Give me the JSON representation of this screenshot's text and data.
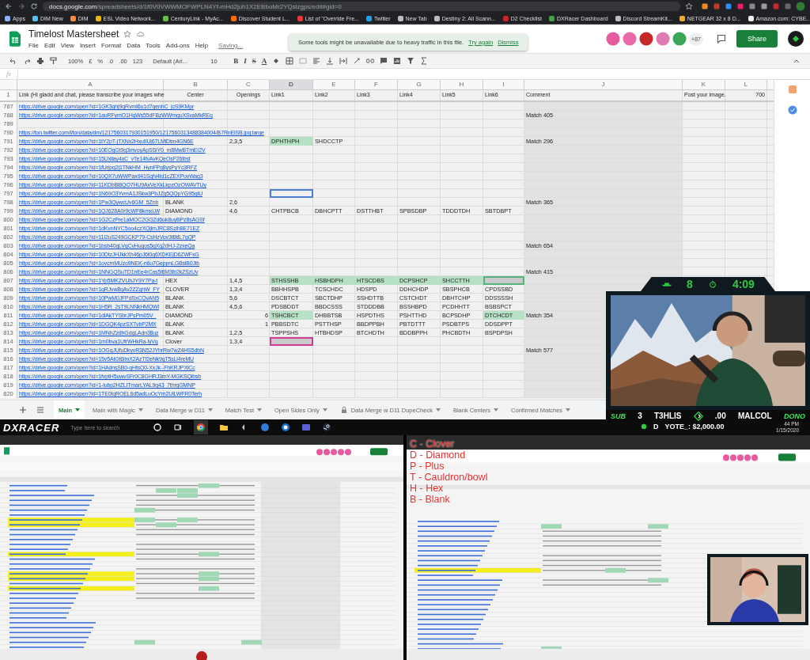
{
  "browser": {
    "url_host": "docs.google.com",
    "url_path": "/spreadsheets/d/1f0V0VWWMOFWPLN4Yf-mHd2juh1X2EBboMr2YQslzgps/edit#gid=0",
    "bookmarks": [
      {
        "label": "Apps",
        "color": "#8ab4f8"
      },
      {
        "label": "DIM New",
        "color": "#4fc3f7"
      },
      {
        "label": "DIM",
        "color": "#ff8a3d"
      },
      {
        "label": "ESL Video Network...",
        "color": "#f5b400"
      },
      {
        "label": "CenturyLink - MyAc...",
        "color": "#6abf4b"
      },
      {
        "label": "Discover Student L...",
        "color": "#ff6d00"
      },
      {
        "label": "List of \"Override Fre...",
        "color": "#e53935"
      },
      {
        "label": "Twitter",
        "color": "#1da1f2"
      },
      {
        "label": "New Tab",
        "color": "#bdbdbd"
      },
      {
        "label": "Destiny 2: All Scann...",
        "color": "#bdbdbd"
      },
      {
        "label": "D2 Checklist",
        "color": "#c62828"
      },
      {
        "label": "DXRacer Dashboard",
        "color": "#43a047"
      },
      {
        "label": "Discord StreamKit...",
        "color": "#bdbdbd"
      },
      {
        "label": "NETGEAR 32 x 8 D...",
        "color": "#f9a825"
      },
      {
        "label": "Amazon.com: CYBE...",
        "color": "#eeeeee"
      }
    ]
  },
  "sheet": {
    "title": "Timelost Mastersheet",
    "menu": [
      "File",
      "Edit",
      "View",
      "Insert",
      "Format",
      "Data",
      "Tools",
      "Add-ons",
      "Help"
    ],
    "save_status": "Saving...",
    "notice": {
      "text": "Some tools might be unavailable due to heavy traffic in this file.",
      "actions": [
        "Try again",
        "Dismiss"
      ]
    },
    "collaborators": [
      {
        "color": "#e85aa0"
      },
      {
        "color": "#e86aa8"
      },
      {
        "color": "#c62828"
      },
      {
        "color": "#e07ab0"
      },
      {
        "color": "#3aa757"
      }
    ],
    "collaborator_count": "+87",
    "share": "Share",
    "toolbar": {
      "zoom": "100%",
      "currency": "£",
      "percent": "%",
      "decimals_less": ".0",
      "decimals_more": ".00",
      "number_format": "123",
      "font": "Default (Ari...",
      "font_size": "10",
      "styles": [
        "B",
        "I",
        "S",
        "A"
      ]
    },
    "formula_label": "fx",
    "columns": [
      {
        "letter": "A",
        "selected": false
      },
      {
        "letter": "B",
        "selected": false
      },
      {
        "letter": "C",
        "selected": false
      },
      {
        "letter": "D",
        "selected": true
      },
      {
        "letter": "E",
        "selected": false
      },
      {
        "letter": "F",
        "selected": false
      },
      {
        "letter": "G",
        "selected": false
      },
      {
        "letter": "H",
        "selected": false
      },
      {
        "letter": "I",
        "selected": false
      },
      {
        "letter": "J",
        "selected": false
      },
      {
        "letter": "K",
        "selected": false
      },
      {
        "letter": "L",
        "selected": false
      }
    ],
    "header_row": {
      "number": "1",
      "cells": [
        "Link (Hi gladd and chat, please transcribe your images whe",
        "Center",
        "Openings",
        "Link1",
        "Link2",
        "Link3",
        "Link4",
        "Link5",
        "Link6",
        "Comment",
        "Post your image.",
        "700"
      ]
    },
    "rows": [
      {
        "number": "787",
        "link": "https://drive.google.com/open?id=1GK3ghj9gRvmI6u1d7genhC_jcS9KMpr"
      },
      {
        "number": "788",
        "link": "https://drive.google.com/open?id=1auRFymO1HqWs55dFBzWWmguXSvaMkREq",
        "comment": "Match 405"
      },
      {
        "number": "789"
      },
      {
        "number": "790",
        "link": "https://ton.twitter.com/i/ton/data/dm/1217560317930151950/1217560313488384004/B7RnElSB.jpg:large"
      },
      {
        "number": "791",
        "link": "https://drive.google.com/open?id=1tY2pT-jTXNx2HxuIIUj67LMlDtm4GN6E",
        "openings": "2,3,5",
        "openings_numeric": false,
        "links": [
          {
            "text": "DPHTHPH",
            "highlighted": true,
            "selected": false
          },
          {
            "text": "SHDCCTP",
            "highlighted": false,
            "selected": false
          },
          {
            "highlighted": false,
            "selected": false
          },
          {
            "highlighted": false,
            "selected": false
          },
          {
            "highlighted": false,
            "selected": false
          },
          {
            "highlighted": false,
            "selected": false
          }
        ],
        "comment": "Match 296"
      },
      {
        "number": "792",
        "link": "https://drive.google.com/open?id=10EOgGt9g3mvoyApSSlY0_m8MwBTmEI2V"
      },
      {
        "number": "793",
        "link": "https://drive.google.com/open?id=15Uxllay4xC_vTe14fvAvKQeOsF26lbst"
      },
      {
        "number": "794",
        "link": "https://drive.google.com/open?id=1fUrjpg2j1TNkHM_HynFPg8ysPyYc3RFZ"
      },
      {
        "number": "795",
        "link": "https://drive.google.com/open?id=10QX7uWWPax941SgN4td1cZEXPovWag3"
      },
      {
        "number": "796",
        "link": "https://drive.google.com/open?id=11KDbBl8QO7HU9AxVeXkLkpzOzOWAVTUy"
      },
      {
        "number": "797",
        "link": "https://drive.google.com/open?id=1N69O3YvmA1JSkw3PbJZg5QQpYG95gIU",
        "links": [
          {
            "highlighted": false,
            "selected": true
          },
          {
            "highlighted": false,
            "selected": false
          },
          {
            "highlighted": false,
            "selected": false
          },
          {
            "highlighted": false,
            "selected": false
          },
          {
            "highlighted": false,
            "selected": false
          },
          {
            "highlighted": false,
            "selected": false
          }
        ]
      },
      {
        "number": "798",
        "link": "https://drive.google.com/open?id=1Pw3QywcUv6GM_5Znh",
        "center": "BLANK",
        "openings": "2,6",
        "openings_numeric": false,
        "comment": "Match 365"
      },
      {
        "number": "799",
        "link": "https://drive.google.com/open?id=1QJ628A0r9cWF8kmxLW",
        "center": "DIAMOND",
        "openings": "4,6",
        "openings_numeric": false,
        "links": [
          {
            "text": "CHTPBCB",
            "highlighted": false,
            "selected": false
          },
          {
            "text": "DBHCPTT",
            "highlighted": false,
            "selected": false
          },
          {
            "text": "DSTTHBT",
            "highlighted": false,
            "selected": false
          },
          {
            "text": "SPBSDBP",
            "highlighted": false,
            "selected": false
          },
          {
            "text": "TDDDTDH",
            "highlighted": false,
            "selected": false
          },
          {
            "text": "SBTDBPT",
            "highlighted": false,
            "selected": false
          }
        ]
      },
      {
        "number": "800",
        "link": "https://drive.google.com/open?id=1G2CzPre1aMOC2GGZd6uk8uyBPz8sAGSf"
      },
      {
        "number": "801",
        "link": "https://drive.google.com/open?id=1dKvnNYC5oo4czXQjimJRC8Szlh8E71EZ"
      },
      {
        "number": "802",
        "link": "https://drive.google.com/open?id=11I2uS249GCKP79-CsHzVov3tBtlL7gQP"
      },
      {
        "number": "803",
        "link": "https://drive.google.com/open?id=1bsb40gLVqCvHuqos5gXq2dHJ-2zxeQa",
        "comment": "Match 654"
      },
      {
        "number": "804",
        "link": "https://drive.google.com/open?id=10DtzJHJkkXh46pJ6t0g6XDKEjD6ZWFxG"
      },
      {
        "number": "805",
        "link": "https://drive.google.com/open?id=1ovcmMUzo9NEK-n6u7GeppnLGBslB0Jlb"
      },
      {
        "number": "806",
        "link": "https://drive.google.com/open?id=1NNGQSuTD1nEe4rCas5l6M3lb2kZSzUv",
        "comment": "Match 415"
      },
      {
        "number": "807",
        "link": "https://drive.google.com/open?id=1Yp5MKZVUhJY9Y7Pa-t",
        "center": "HEX",
        "openings": "1,4,5",
        "openings_numeric": false,
        "links": [
          {
            "text": "STHSSHB",
            "highlighted": true,
            "selected": false
          },
          {
            "text": "HSBHDPH",
            "highlighted": true,
            "selected": false
          },
          {
            "text": "HTSCDBS",
            "highlighted": true,
            "selected": false
          },
          {
            "text": "DCPSHCP",
            "highlighted": true,
            "selected": false
          },
          {
            "text": "SHCCTTH",
            "highlighted": true,
            "selected": false
          },
          {
            "highlighted": false,
            "selected": false,
            "color": "#56b37a"
          }
        ]
      },
      {
        "number": "808",
        "link": "https://drive.google.com/open?id=1qRJvw8qAv2ZZqhW_FY",
        "center": "CLOVER",
        "openings": "1,3,4",
        "openings_numeric": false,
        "links": [
          {
            "text": "BBHHSPB",
            "highlighted": false,
            "selected": false
          },
          {
            "text": "TCSCHDC",
            "highlighted": false,
            "selected": false
          },
          {
            "text": "HDSPD",
            "highlighted": false,
            "selected": false
          },
          {
            "text": "DDHCHDP",
            "highlighted": false,
            "selected": false
          },
          {
            "text": "SBSPHCB",
            "highlighted": false,
            "selected": false
          },
          {
            "text": "CPDSSBD",
            "highlighted": false,
            "selected": false
          }
        ]
      },
      {
        "number": "809",
        "link": "https://drive.google.com/open?id=10PwM0JFPdSxCQvAN5",
        "center": "BLANK",
        "openings": "5,6",
        "openings_numeric": false,
        "links": [
          {
            "text": "DSCBTCT",
            "highlighted": false,
            "selected": false
          },
          {
            "text": "SBCTDHP",
            "highlighted": false,
            "selected": false
          },
          {
            "text": "SSHDTTB",
            "highlighted": false,
            "selected": false
          },
          {
            "text": "CSTCHDT",
            "highlighted": false,
            "selected": false
          },
          {
            "text": "DBHTCHP",
            "highlighted": false,
            "selected": false
          },
          {
            "text": "DDSSSSH",
            "highlighted": false,
            "selected": false
          }
        ]
      },
      {
        "number": "810",
        "link": "https://drive.google.com/open?id=1H5R_2sT9LNNkHMQWl",
        "center": "BLANK",
        "openings": "4,5,6",
        "openings_numeric": false,
        "links": [
          {
            "text": "PDSBDDT",
            "highlighted": false,
            "selected": false
          },
          {
            "text": "BBDCSSS",
            "highlighted": false,
            "selected": false
          },
          {
            "text": "STDDDBB",
            "highlighted": false,
            "selected": false
          },
          {
            "text": "BSSHBPD",
            "highlighted": false,
            "selected": false
          },
          {
            "text": "PCDHHTT",
            "highlighted": false,
            "selected": false
          },
          {
            "text": "BSBSPCT",
            "highlighted": false,
            "selected": false
          }
        ]
      },
      {
        "number": "811",
        "link": "https://drive.google.com/open?id=1dlAkTYSbrJPsPm05V_",
        "center": "DIAMOND",
        "openings": "6",
        "openings_numeric": true,
        "links": [
          {
            "text": "TSHCBCT",
            "highlighted": true,
            "selected": false
          },
          {
            "text": "DHBBTSB",
            "highlighted": false,
            "selected": false
          },
          {
            "text": "HSPDTHS",
            "highlighted": false,
            "selected": false
          },
          {
            "text": "PSHTTHD",
            "highlighted": false,
            "selected": false
          },
          {
            "text": "BCPSDHP",
            "highlighted": false,
            "selected": false
          },
          {
            "text": "DTCHCDT",
            "highlighted": true,
            "selected": false
          }
        ],
        "comment": "Match 354"
      },
      {
        "number": "812",
        "link": "https://drive.google.com/open?id=1DGQK4pzSXTvbP2MX",
        "center": "BLANK",
        "openings": "1",
        "openings_numeric": true,
        "links": [
          {
            "text": "PBBSDTC",
            "highlighted": false,
            "selected": false
          },
          {
            "text": "PSTTHSP",
            "highlighted": false,
            "selected": false
          },
          {
            "text": "BBDPPBH",
            "highlighted": false,
            "selected": false
          },
          {
            "text": "PBTDTTT",
            "highlighted": false,
            "selected": false
          },
          {
            "text": "PSDBTPS",
            "highlighted": false,
            "selected": false
          },
          {
            "text": "DDSDPPT",
            "highlighted": false,
            "selected": false
          }
        ]
      },
      {
        "number": "813",
        "link": "https://drive.google.com/open?id=1MNhZzdhGdqLAdn38uz",
        "center": "BLANK",
        "openings": "1,2,5",
        "openings_numeric": false,
        "links": [
          {
            "text": "TSPPSHS",
            "highlighted": false,
            "selected": false
          },
          {
            "text": "HTBHDSP",
            "highlighted": false,
            "selected": false
          },
          {
            "text": "BTCHDTH",
            "highlighted": false,
            "selected": false
          },
          {
            "text": "BDDBPPH",
            "highlighted": false,
            "selected": false
          },
          {
            "text": "PHCBDTH",
            "highlighted": false,
            "selected": false
          },
          {
            "text": "BSPDPSH",
            "highlighted": false,
            "selected": false
          }
        ]
      },
      {
        "number": "814",
        "link": "https://drive.google.com/open?id=1m0bva1UfrWHkRa-lyVq",
        "center": "Clover",
        "openings": "1,3,4",
        "openings_numeric": false,
        "links": [
          {
            "highlighted": false,
            "selected": false,
            "color": "#d03c8f"
          },
          {
            "highlighted": false,
            "selected": false
          },
          {
            "highlighted": false,
            "selected": false
          },
          {
            "highlighted": false,
            "selected": false
          },
          {
            "highlighted": false,
            "selected": false
          },
          {
            "highlighted": false,
            "selected": false
          }
        ]
      },
      {
        "number": "815",
        "link": "https://drive.google.com/open?id=1OGqJUfuDkyvR3N52JYhrRw7wZ4HS5dbN",
        "comment": "Match 577"
      },
      {
        "number": "816",
        "link": "https://drive.google.com/open?id=15v5AtGt6lmX2AzTf2eNk9qT5sLl4reMU"
      },
      {
        "number": "817",
        "link": "https://drive.google.com/open?id=1HAdnsSB0-gHtsQ0-XxJk--FhKRJPXlCc"
      },
      {
        "number": "818",
        "link": "https://drive.google.com/open?id=1fvptH5uwvSFr0C8GHRJ3mY-MGKSQlbsb"
      },
      {
        "number": "819",
        "link": "https://drive.google.com/open?id=1-lubp2HZLITmarLYAL9g43_7thrgGMNP"
      },
      {
        "number": "820",
        "link": "https://drive.google.com/open?id=1TE0IqROEL6d5adLuOcYm2UlLWFR0Terh"
      }
    ],
    "tabs": [
      {
        "label": "Main",
        "selected": true,
        "locked": false
      },
      {
        "label": "Main with Magic",
        "selected": false,
        "locked": false
      },
      {
        "label": "Data Merge w D11",
        "selected": false,
        "locked": false
      },
      {
        "label": "Match Test",
        "selected": false,
        "locked": false
      },
      {
        "label": "Open Sides Only",
        "selected": false,
        "locked": false
      },
      {
        "label": "Data Merge w D11 DupeCheck",
        "selected": false,
        "locked": true
      },
      {
        "label": "Blank Centers",
        "selected": false,
        "locked": false
      },
      {
        "label": "Confirmed Matches",
        "selected": false,
        "locked": false
      }
    ]
  },
  "stream_overlay": {
    "counter": "8",
    "timer": "4:09",
    "ticker": [
      {
        "text": "SUB",
        "kind": "tag"
      },
      {
        "text": "3",
        "kind": "name"
      },
      {
        "text": "T3HLIS",
        "kind": "name"
      },
      {
        "kind": "logo"
      },
      {
        "text": ".00",
        "kind": "name"
      },
      {
        "text": "MALCOL",
        "kind": "name"
      },
      {
        "text": "DONO",
        "kind": "tag"
      }
    ],
    "ticker2": [
      "D",
      "YOTE_: $2,000.00"
    ]
  },
  "taskbar": {
    "logo": "DXRACER",
    "search": "Type here to search",
    "time": "44 PM",
    "date": "1/15/2020"
  },
  "second_screen": {
    "legend": [
      "C - Clover",
      "D - Diamond",
      "P - Plus",
      "T - Cauldron/bowl",
      "H - Hex",
      "B - Blank"
    ]
  }
}
